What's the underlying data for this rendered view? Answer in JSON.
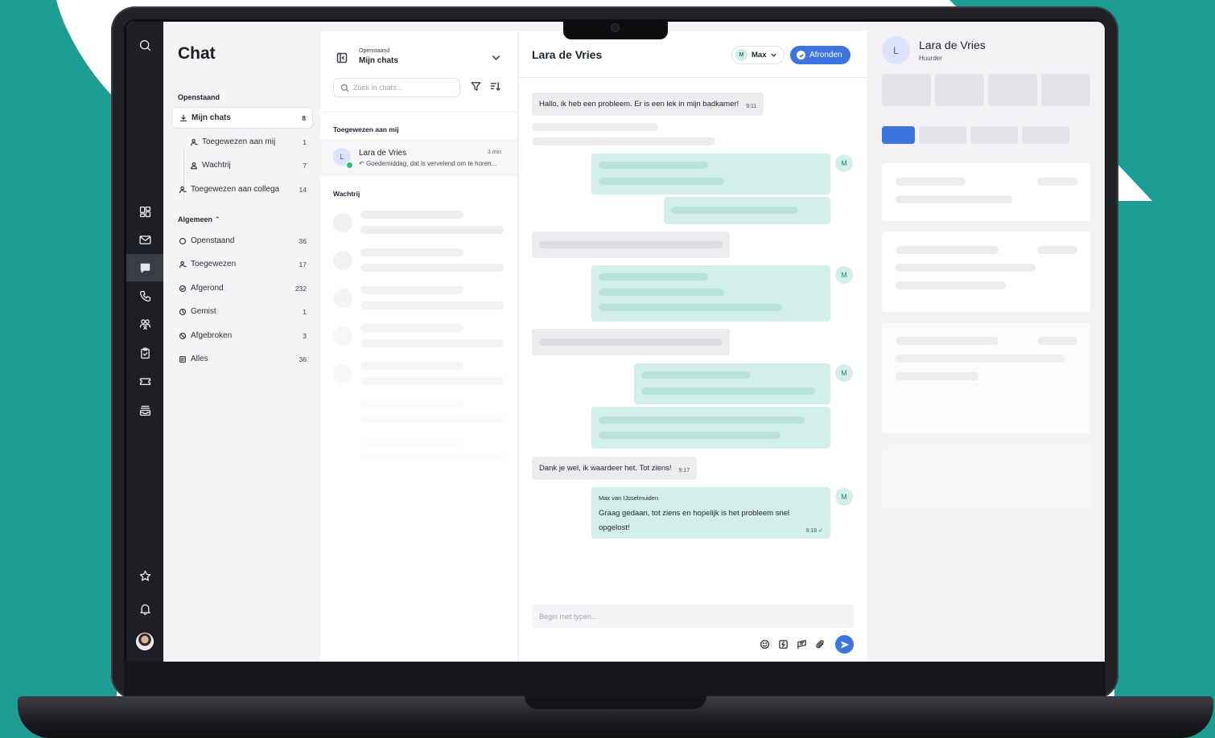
{
  "colors": {
    "teal_background": "#1d9e95",
    "rail_background": "#1d1f25",
    "accent_blue": "#3d74e0",
    "outgoing_bubble": "#d3efe9",
    "incoming_bubble": "#ececef"
  },
  "rail": {
    "icons": [
      "search-icon",
      "dashboard-icon",
      "mail-icon",
      "chat-icon",
      "phone-icon",
      "contacts-icon",
      "clipboard-icon",
      "ticket-icon",
      "inbox-stack-icon",
      "star-icon",
      "bell-icon"
    ],
    "active": "chat-icon"
  },
  "folders": {
    "title": "Chat",
    "open_section": "Openstaand",
    "my_chats": {
      "label": "Mijn chats",
      "count": "8"
    },
    "assigned_to_me": {
      "label": "Toegewezen aan mij",
      "count": "1"
    },
    "queue": {
      "label": "Wachtrij",
      "count": "7"
    },
    "assigned_to_colleague": {
      "label": "Toegewezen aan collega",
      "count": "14"
    },
    "general_section": "Algemeen",
    "general_items": [
      {
        "label": "Openstaand",
        "count": "36",
        "icon": "circle-icon"
      },
      {
        "label": "Toegewezen",
        "count": "17",
        "icon": "user-icon"
      },
      {
        "label": "Afgerond",
        "count": "232",
        "icon": "check-circle-icon"
      },
      {
        "label": "Gemist",
        "count": "1",
        "icon": "clock-icon"
      },
      {
        "label": "Afgebroken",
        "count": "3",
        "icon": "ban-icon"
      },
      {
        "label": "Alles",
        "count": "36",
        "icon": "list-icon"
      }
    ]
  },
  "chatlist": {
    "header_sub": "Openstaand",
    "header_title": "Mijn chats",
    "search_placeholder": "Zoek in chats...",
    "section_assigned": "Toegewezen aan mij",
    "section_queue": "Wachtrij",
    "active_chat": {
      "avatar": "L",
      "name": "Lara de Vries",
      "time": "3 min",
      "preview": "Goedemiddag, dat is vervelend om te horen..."
    }
  },
  "conversation": {
    "title": "Lara de Vries",
    "agent": "Max",
    "agent_initial": "M",
    "finish_label": "Afronden",
    "first_message": {
      "text": "Hallo, ik heb een probleem. Er is een lek in mijn badkamer!",
      "time": "9:11"
    },
    "thanks_message": {
      "text": "Dank je wel, ik waardeer het. Tot ziens!",
      "time": "9:17"
    },
    "reply": {
      "author": "Max van IJsselmuiden",
      "text": "Graag gedaan, tot ziens en hopelijk is het probleem snel opgelost!",
      "time": "9:18 ✓"
    },
    "composer_placeholder": "Begin met typen..."
  },
  "contact": {
    "avatar": "L",
    "name": "Lara de Vries",
    "role": "Huurder"
  }
}
